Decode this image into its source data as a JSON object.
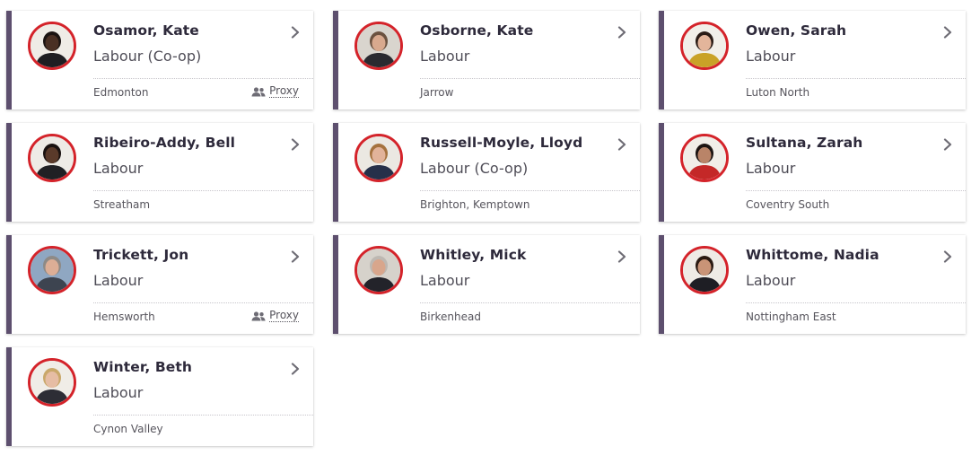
{
  "members": [
    {
      "name": "Osamor, Kate",
      "party": "Labour (Co-op)",
      "constituency": "Edmonton",
      "proxy": "Proxy",
      "skin": "#4a3024",
      "hair": "#1b1412",
      "suit": "#1e1e22",
      "bg": "#efece6"
    },
    {
      "name": "Osborne, Kate",
      "party": "Labour",
      "constituency": "Jarrow",
      "proxy": "",
      "skin": "#d8a98e",
      "hair": "#6b5240",
      "suit": "#2a2a30",
      "bg": "#d9d5ce"
    },
    {
      "name": "Owen, Sarah",
      "party": "Labour",
      "constituency": "Luton North",
      "proxy": "",
      "skin": "#e3b59b",
      "hair": "#2a1c16",
      "suit": "#c9a227",
      "bg": "#f1efe9"
    },
    {
      "name": "Ribeiro-Addy, Bell",
      "party": "Labour",
      "constituency": "Streatham",
      "proxy": "",
      "skin": "#5a3a2a",
      "hair": "#1a1210",
      "suit": "#202024",
      "bg": "#eeebe6"
    },
    {
      "name": "Russell-Moyle, Lloyd",
      "party": "Labour (Co-op)",
      "constituency": "Brighton, Kemptown",
      "proxy": "",
      "skin": "#e2b39a",
      "hair": "#a5723e",
      "suit": "#26304a",
      "bg": "#ebe8e2"
    },
    {
      "name": "Sultana, Zarah",
      "party": "Labour",
      "constituency": "Coventry South",
      "proxy": "",
      "skin": "#b98468",
      "hair": "#1c1412",
      "suit": "#c42828",
      "bg": "#f1eee8"
    },
    {
      "name": "Trickett, Jon",
      "party": "Labour",
      "constituency": "Hemsworth",
      "proxy": "Proxy",
      "skin": "#dcae96",
      "hair": "#8e8a86",
      "suit": "#3d4450",
      "bg": "#8fa7c2"
    },
    {
      "name": "Whitley, Mick",
      "party": "Labour",
      "constituency": "Birkenhead",
      "proxy": "",
      "skin": "#d8a68c",
      "hair": "#bdb8b2",
      "suit": "#23232a",
      "bg": "#d6d2cb"
    },
    {
      "name": "Whittome, Nadia",
      "party": "Labour",
      "constituency": "Nottingham East",
      "proxy": "",
      "skin": "#c99477",
      "hair": "#2a1a12",
      "suit": "#1e1e24",
      "bg": "#eeebe5"
    },
    {
      "name": "Winter, Beth",
      "party": "Labour",
      "constituency": "Cynon Valley",
      "proxy": "",
      "skin": "#e6bda4",
      "hair": "#c9a86a",
      "suit": "#2d2d35",
      "bg": "#f0ede7"
    }
  ],
  "colors": {
    "accent_bar": "#5d4f6e",
    "avatar_ring": "#d4232a"
  },
  "icons": {
    "chevron": "chevron-right-icon",
    "proxy": "people-icon"
  }
}
